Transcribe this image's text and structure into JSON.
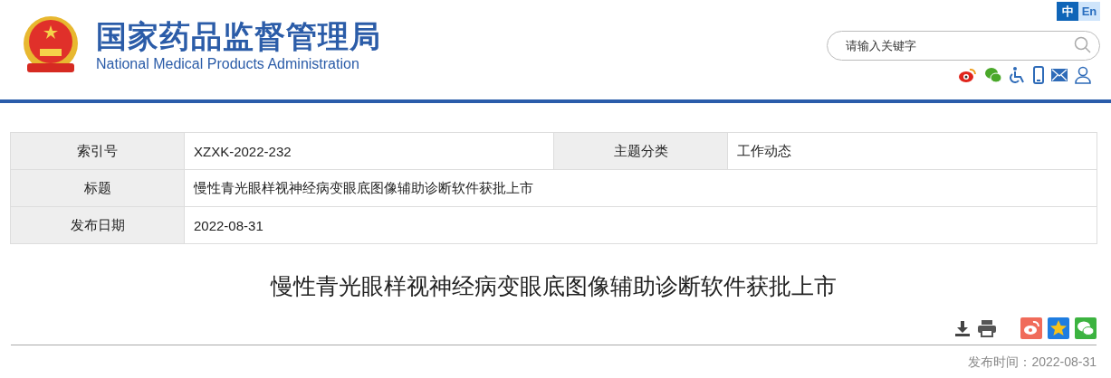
{
  "header": {
    "title": "国家药品监督管理局",
    "subtitle": "National Medical Products Administration",
    "languages": [
      {
        "label": "中",
        "selected": true
      },
      {
        "label": "En",
        "selected": false
      }
    ],
    "search": {
      "placeholder": "请输入关键字"
    }
  },
  "info_table": {
    "rows": [
      {
        "cells": [
          {
            "label": "索引号",
            "value": "XZXK-2022-232"
          },
          {
            "label": "主题分类",
            "value": "工作动态"
          }
        ]
      },
      {
        "cells": [
          {
            "label": "标题",
            "value": "慢性青光眼样视神经病变眼底图像辅助诊断软件获批上市"
          }
        ]
      },
      {
        "cells": [
          {
            "label": "发布日期",
            "value": "2022-08-31"
          }
        ]
      }
    ]
  },
  "article": {
    "title": "慢性青光眼样视神经病变眼底图像辅助诊断软件获批上市",
    "publish_time": "发布时间：2022-08-31"
  }
}
